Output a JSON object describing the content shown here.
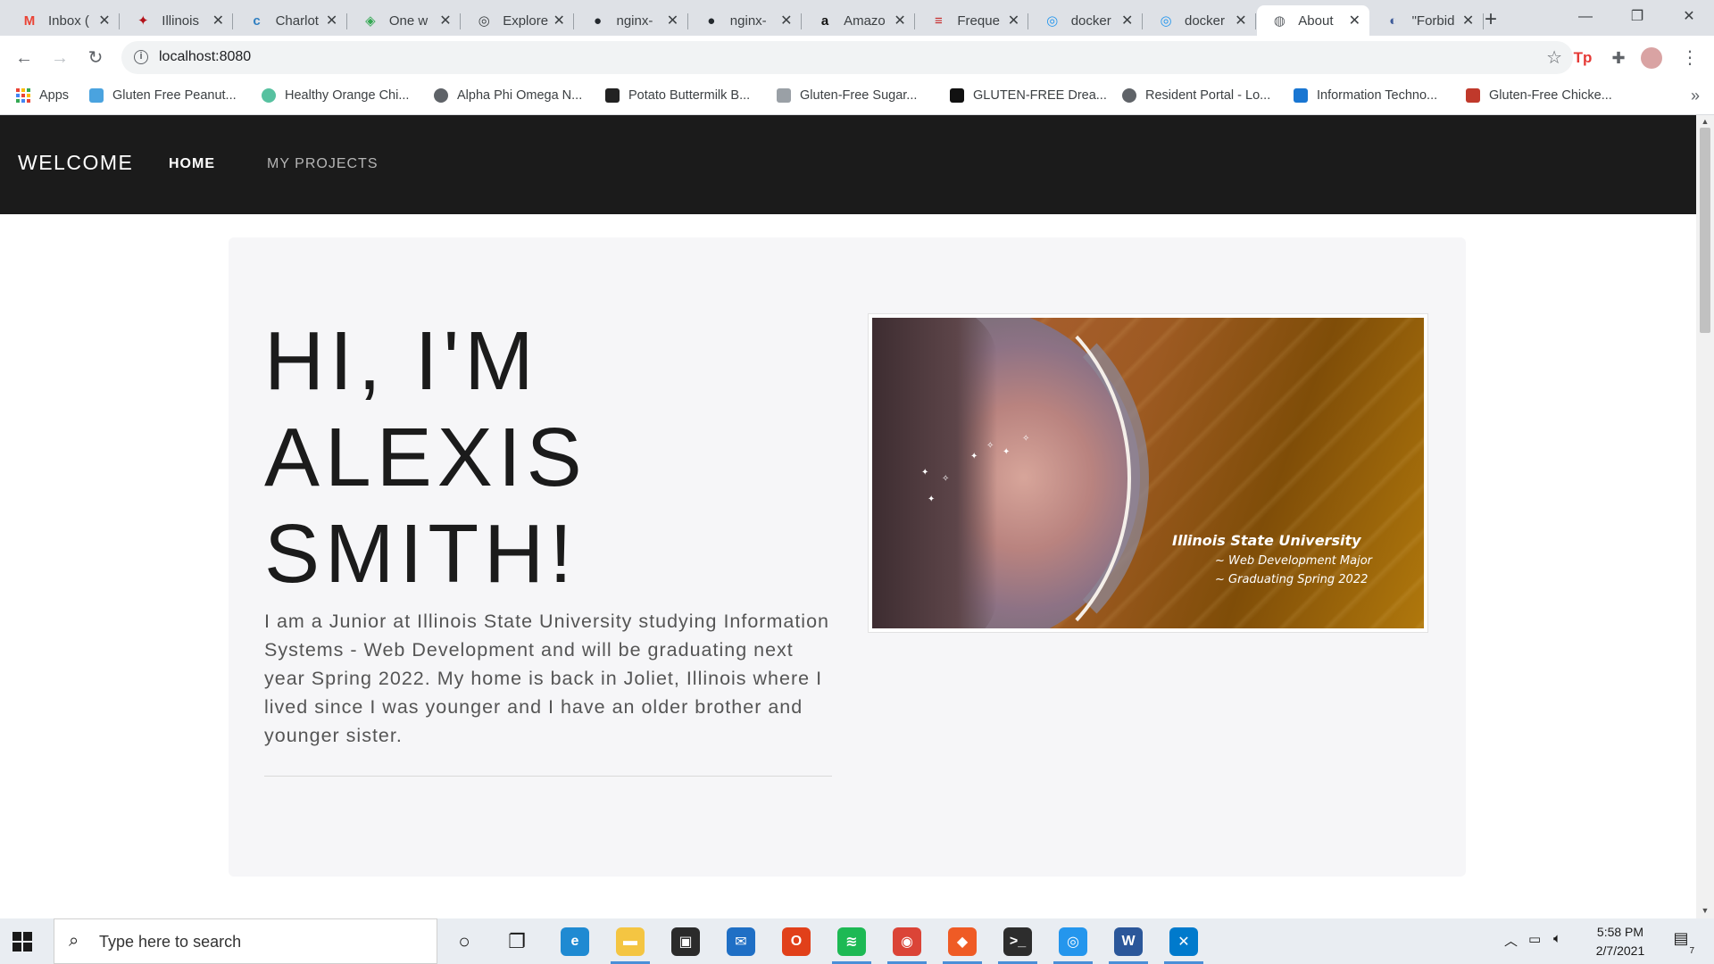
{
  "browser": {
    "tabs": [
      {
        "title": "Inbox (",
        "icon": "gmail-icon",
        "color": "#ea4335",
        "glyph": "M"
      },
      {
        "title": "Illinois",
        "icon": "cardinal-icon",
        "color": "#b3121a",
        "glyph": "✦"
      },
      {
        "title": "Charlot",
        "icon": "cltr-icon",
        "color": "#2f7fc1",
        "glyph": "c"
      },
      {
        "title": "One w",
        "icon": "google-maps-icon",
        "color": "#34a853",
        "glyph": "◈"
      },
      {
        "title": "Explore",
        "icon": "docker-hub-icon",
        "color": "#3c4043",
        "glyph": "◎"
      },
      {
        "title": "nginx-",
        "icon": "github-icon",
        "color": "#24292e",
        "glyph": "●"
      },
      {
        "title": "nginx-",
        "icon": "github-icon",
        "color": "#24292e",
        "glyph": "●"
      },
      {
        "title": "Amazo",
        "icon": "amazon-icon",
        "color": "#111111",
        "glyph": "a"
      },
      {
        "title": "Freque",
        "icon": "us-flag-icon",
        "color": "#c62828",
        "glyph": "≡"
      },
      {
        "title": "docker",
        "icon": "docker-icon",
        "color": "#2496ed",
        "glyph": "◎"
      },
      {
        "title": "docker",
        "icon": "docker-icon",
        "color": "#2496ed",
        "glyph": "◎"
      },
      {
        "title": "About",
        "icon": "globe-icon",
        "color": "#5f6368",
        "glyph": "◍",
        "active": true
      },
      {
        "title": "\"Forbid",
        "icon": "firefox-icon",
        "color": "#3d5a99",
        "glyph": "◐"
      }
    ],
    "url": "localhost:8080",
    "bookmarks": [
      {
        "label": "Apps",
        "icon": "apps-grid-icon"
      },
      {
        "label": "Gluten Free Peanut...",
        "icon": "recipe-icon",
        "color": "#4aa3df"
      },
      {
        "label": "Healthy Orange Chi...",
        "icon": "leaf-icon",
        "color": "#57c1a0"
      },
      {
        "label": "Alpha Phi Omega N...",
        "icon": "globe-icon",
        "color": "#5f6368"
      },
      {
        "label": "Potato Buttermilk B...",
        "icon": "bakery-icon",
        "color": "#222222"
      },
      {
        "label": "Gluten-Free Sugar...",
        "icon": "link-icon",
        "color": "#9aa0a6"
      },
      {
        "label": "GLUTEN-FREE Drea...",
        "icon": "f-logo-icon",
        "color": "#111111"
      },
      {
        "label": "Resident Portal - Lo...",
        "icon": "globe-icon",
        "color": "#5f6368"
      },
      {
        "label": "Information Techno...",
        "icon": "it-logo-icon",
        "color": "#1976d2"
      },
      {
        "label": "Gluten-Free Chicke...",
        "icon": "recipe-icon",
        "color": "#c0392b"
      }
    ]
  },
  "site": {
    "brand": "WELCOME",
    "nav": {
      "home": "HOME",
      "projects": "MY PROJECTS"
    },
    "hero": {
      "title": "HI, I'M ALEXIS SMITH!",
      "bio": "I am a Junior at Illinois State University studying Information Systems - Web Development and will be graduating next year Spring 2022. My home is back in Joliet, Illinois where I lived since I was younger and I have an older brother and younger sister."
    },
    "photo": {
      "caption_title": "Illinois State University",
      "caption_line1": "~ Web Development Major",
      "caption_line2": "~ Graduating Spring 2022"
    }
  },
  "taskbar": {
    "search_placeholder": "Type here to search",
    "time": "5:58 PM",
    "date": "2/7/2021",
    "notification_count": "7",
    "apps": [
      {
        "name": "cortana-icon",
        "color": "#1a1a1a",
        "glyph": "○"
      },
      {
        "name": "task-view-icon",
        "color": "#1a1a1a",
        "glyph": "❐"
      },
      {
        "name": "edge-icon",
        "color": "#1f8ad2",
        "glyph": "e"
      },
      {
        "name": "file-explorer-icon",
        "color": "#f4c542",
        "glyph": "▬"
      },
      {
        "name": "store-icon",
        "color": "#2b2b2b",
        "glyph": "▣"
      },
      {
        "name": "mail-icon",
        "color": "#1f6fc5",
        "glyph": "✉"
      },
      {
        "name": "office-icon",
        "color": "#e1401a",
        "glyph": "O"
      },
      {
        "name": "spotify-icon",
        "color": "#1db954",
        "glyph": "≋"
      },
      {
        "name": "chrome-icon",
        "color": "#db4437",
        "glyph": "◉"
      },
      {
        "name": "postman-icon",
        "color": "#ef5b25",
        "glyph": "◆"
      },
      {
        "name": "terminal-icon",
        "color": "#2d2d2d",
        "glyph": ">_"
      },
      {
        "name": "docker-desktop-icon",
        "color": "#2496ed",
        "glyph": "◎"
      },
      {
        "name": "word-icon",
        "color": "#2b579a",
        "glyph": "W"
      },
      {
        "name": "vscode-icon",
        "color": "#007acc",
        "glyph": "✕"
      }
    ]
  }
}
